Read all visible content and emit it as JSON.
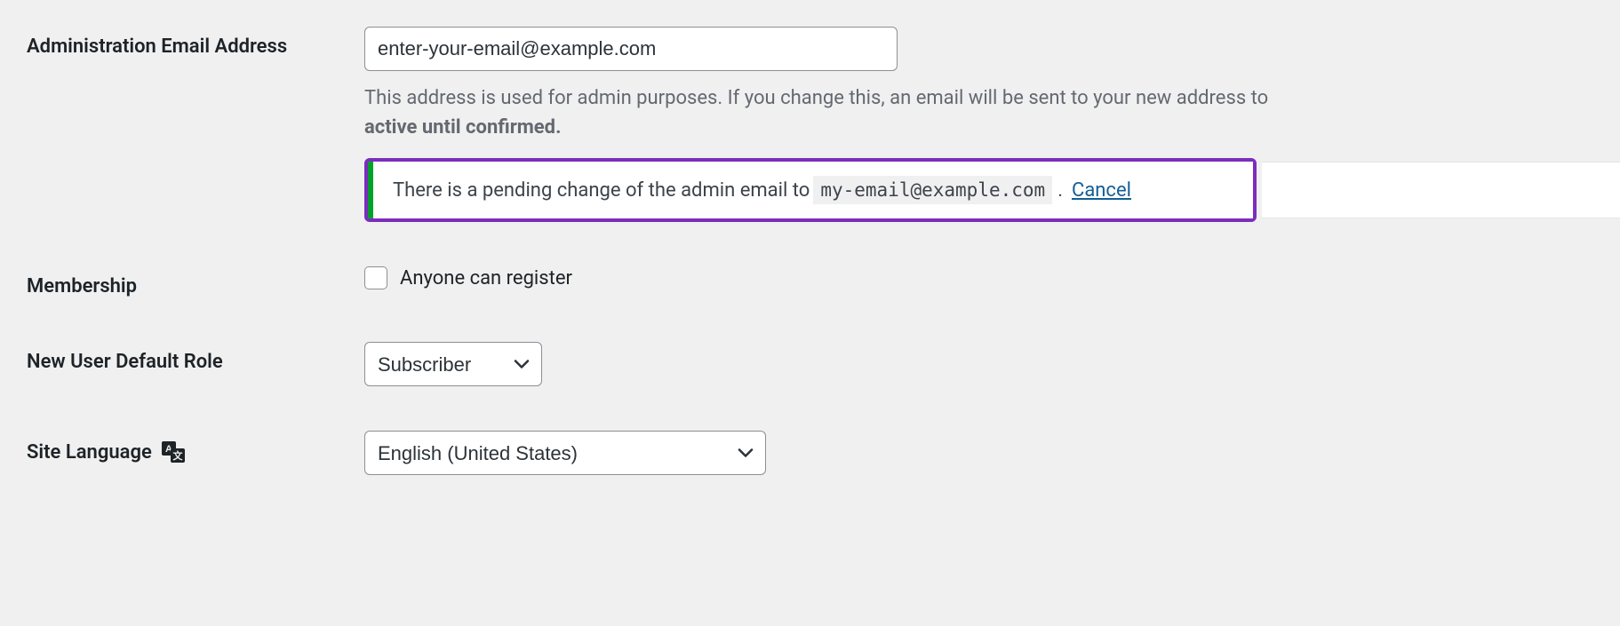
{
  "admin_email": {
    "label": "Administration Email Address",
    "value": "enter-your-email@example.com",
    "description_part1": "This address is used for admin purposes. If you change this, an email will be sent to your new address to",
    "description_strong": "active until confirmed.",
    "notice_text": "There is a pending change of the admin email to ",
    "notice_email": "my-email@example.com",
    "notice_dot": ".",
    "notice_cancel": "Cancel"
  },
  "membership": {
    "label": "Membership",
    "checkbox_label": "Anyone can register"
  },
  "default_role": {
    "label": "New User Default Role",
    "value": "Subscriber"
  },
  "site_language": {
    "label": "Site Language",
    "value": "English (United States)"
  }
}
